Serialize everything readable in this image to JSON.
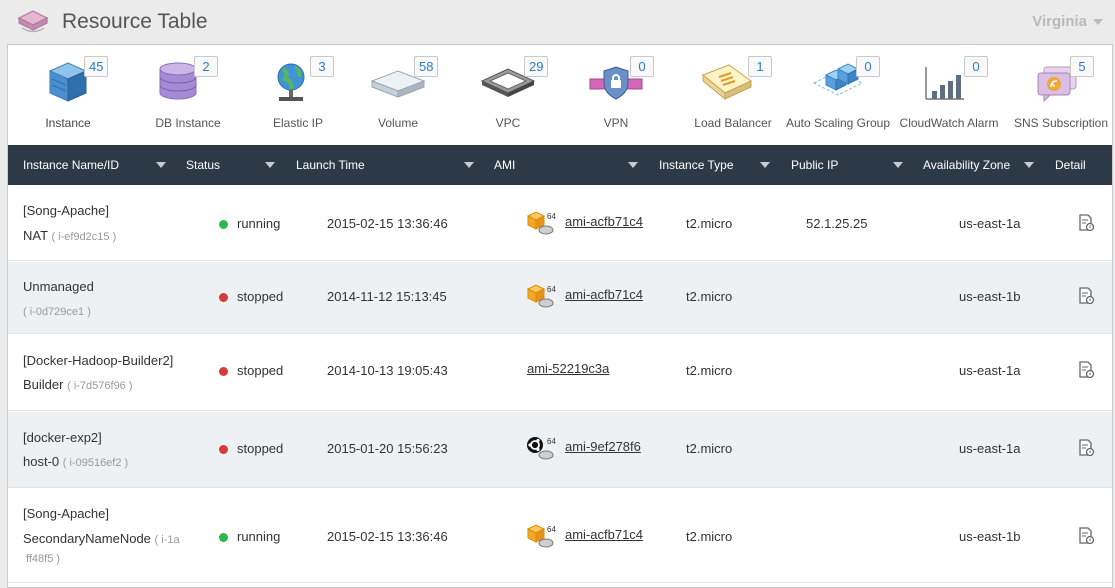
{
  "app": {
    "title": "Resource Table",
    "region": "Virginia"
  },
  "resources": [
    {
      "label": "Instance",
      "count": "45",
      "icon": "instance-icon"
    },
    {
      "label": "DB Instance",
      "count": "2",
      "icon": "db-instance-icon"
    },
    {
      "label": "Elastic IP",
      "count": "3",
      "icon": "elastic-ip-icon"
    },
    {
      "label": "Volume",
      "count": "58",
      "icon": "volume-icon"
    },
    {
      "label": "VPC",
      "count": "29",
      "icon": "vpc-icon"
    },
    {
      "label": "VPN",
      "count": "0",
      "icon": "vpn-icon"
    },
    {
      "label": "Load Balancer",
      "count": "1",
      "icon": "load-balancer-icon"
    },
    {
      "label": "Auto Scaling Group",
      "count": "0",
      "icon": "auto-scaling-group-icon"
    },
    {
      "label": "CloudWatch Alarm",
      "count": "0",
      "icon": "cloudwatch-alarm-icon"
    },
    {
      "label": "SNS Subscription",
      "count": "5",
      "icon": "sns-subscription-icon"
    }
  ],
  "table": {
    "columns": [
      "Instance Name/ID",
      "Status",
      "Launch Time",
      "AMI",
      "Instance Type",
      "Public IP",
      "Availability Zone",
      "Detail"
    ],
    "rows": [
      {
        "name1": "[Song-Apache]",
        "name2": "NAT",
        "id": "( i-ef9d2c15 )",
        "id2": "",
        "status": "running",
        "launch": "2015-02-15 13:36:46",
        "ami": "ami-acfb71c4",
        "ami_icon": "amazon-linux-64-icon",
        "ami_bits": "64",
        "type": "t2.micro",
        "ip": "52.1.25.25",
        "zone": "us-east-1a"
      },
      {
        "name1": "Unmanaged",
        "name2": "",
        "id": "( i-0d729ce1 )",
        "id2": "",
        "status": "stopped",
        "launch": "2014-11-12 15:13:45",
        "ami": "ami-acfb71c4",
        "ami_icon": "amazon-linux-64-icon",
        "ami_bits": "64",
        "type": "t2.micro",
        "ip": "",
        "zone": "us-east-1b"
      },
      {
        "name1": "[Docker-Hadoop-Builder2]",
        "name2": "Builder",
        "id": "( i-7d576f96 )",
        "id2": "",
        "status": "stopped",
        "launch": "2014-10-13 19:05:43",
        "ami": "ami-52219c3a",
        "ami_icon": "",
        "ami_bits": "",
        "type": "t2.micro",
        "ip": "",
        "zone": "us-east-1a"
      },
      {
        "name1": "[docker-exp2]",
        "name2": "host-0",
        "id": "( i-09516ef2 )",
        "id2": "",
        "status": "stopped",
        "launch": "2015-01-20 15:56:23",
        "ami": "ami-9ef278f6",
        "ami_icon": "ubuntu-64-icon",
        "ami_bits": "64",
        "type": "t2.micro",
        "ip": "",
        "zone": "us-east-1a"
      },
      {
        "name1": "[Song-Apache]",
        "name2": "SecondaryNameNode",
        "id": "( i-1a",
        "id2": "ff48f5 )",
        "status": "running",
        "launch": "2015-02-15 13:36:46",
        "ami": "ami-acfb71c4",
        "ami_icon": "amazon-linux-64-icon",
        "ami_bits": "64",
        "type": "t2.micro",
        "ip": "",
        "zone": "us-east-1b"
      }
    ]
  }
}
